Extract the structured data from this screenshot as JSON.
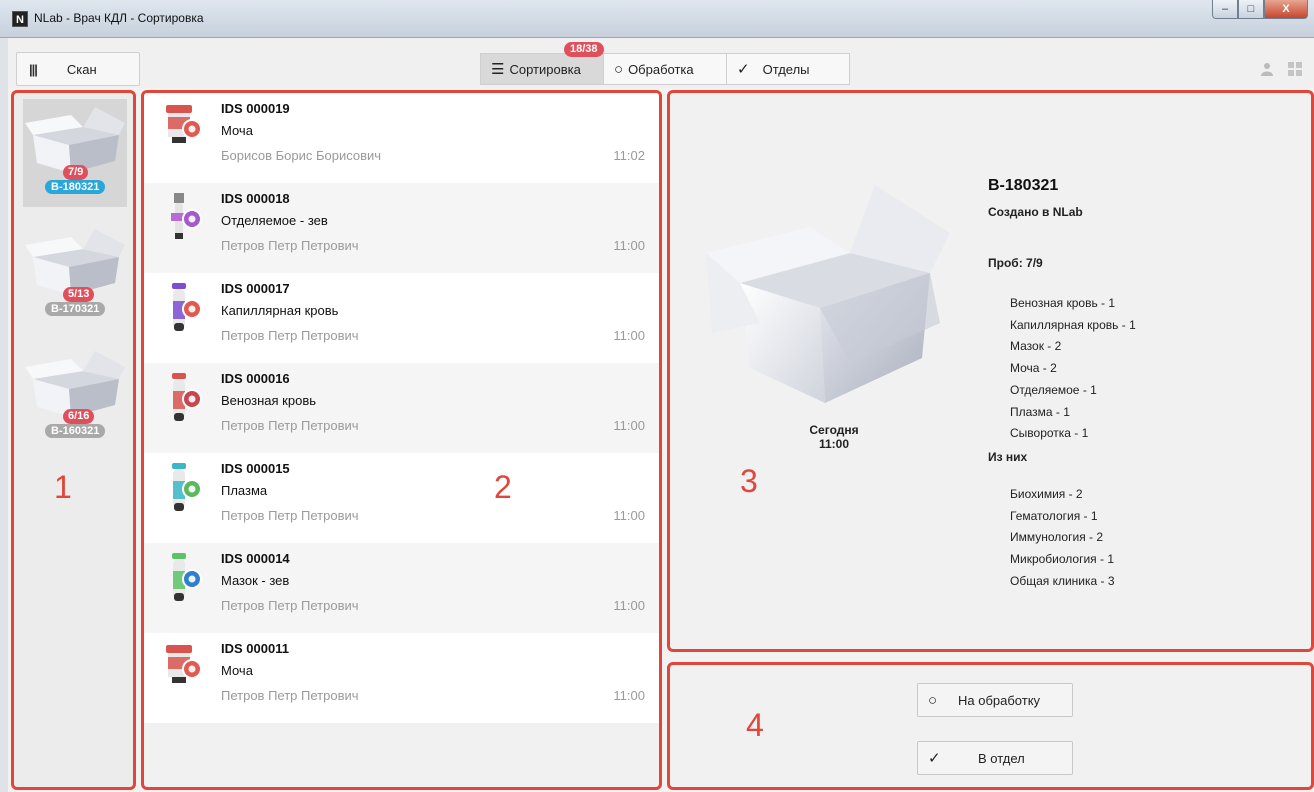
{
  "window": {
    "title": "NLab - Врач КДЛ - Сортировка",
    "app_icon": "N"
  },
  "toolbar": {
    "scan_label": "Скан",
    "tabs": [
      {
        "label": "Сортировка",
        "icon": "menu-icon",
        "active": true
      },
      {
        "label": "Обработка",
        "icon": "circle-icon",
        "active": false
      },
      {
        "label": "Отделы",
        "icon": "check-icon",
        "active": false
      }
    ],
    "badge": "18/38"
  },
  "annotations": {
    "n1": "1",
    "n2": "2",
    "n3": "3",
    "n4": "4"
  },
  "boxes": [
    {
      "count": "7/9",
      "code": "B-180321",
      "color": "#2aa7d9",
      "selected": true
    },
    {
      "count": "5/13",
      "code": "B-170321",
      "color": "#a9a9a9",
      "selected": false
    },
    {
      "count": "6/16",
      "code": "B-160321",
      "color": "#a9a9a9",
      "selected": false
    }
  ],
  "samples": [
    {
      "id": "IDS 000019",
      "type": "Моча",
      "patient": "Борисов Борис Борисович",
      "time": "11:02",
      "tube": "cup",
      "color": "#d9534f",
      "badge": "#e05a50"
    },
    {
      "id": "IDS 000018",
      "type": "Отделяемое -  зев",
      "patient": "Петров Петр Петрович",
      "time": "11:00",
      "tube": "swab",
      "color": "#b86ad9",
      "badge": "#a35acb"
    },
    {
      "id": "IDS 000017",
      "type": "Капиллярная кровь",
      "patient": "Петров Петр Петрович",
      "time": "11:00",
      "tube": "tube",
      "color": "#7b4fd0",
      "badge": "#e05a50"
    },
    {
      "id": "IDS 000016",
      "type": "Венозная кровь",
      "patient": "Петров Петр Петрович",
      "time": "11:00",
      "tube": "tube",
      "color": "#d9534f",
      "badge": "#c9464e"
    },
    {
      "id": "IDS 000015",
      "type": "Плазма",
      "patient": "Петров Петр Петрович",
      "time": "11:00",
      "tube": "tube",
      "color": "#3bb7c8",
      "badge": "#5cb85c"
    },
    {
      "id": "IDS 000014",
      "type": "Мазок -  зев",
      "patient": "Петров Петр Петрович",
      "time": "11:00",
      "tube": "tube",
      "color": "#5cc466",
      "badge": "#2f7fd0"
    },
    {
      "id": "IDS 000011",
      "type": "Моча",
      "patient": "Петров Петр Петрович",
      "time": "11:00",
      "tube": "cup",
      "color": "#d9534f",
      "badge": "#e05a50"
    }
  ],
  "detail": {
    "code": "B-180321",
    "created": "Создано в NLab",
    "date_line1": "Сегодня",
    "date_line2": "11:00",
    "probes": "Проб: 7/9",
    "probe_list": [
      "Венозная кровь - 1",
      "Капиллярная кровь - 1",
      "Мазок - 2",
      "Моча - 2",
      "Отделяемое - 1",
      "Плазма - 1",
      "Сыворотка - 1"
    ],
    "of_them": "Из них",
    "dept_list": [
      "Биохимия - 2",
      "Гематология - 1",
      "Иммунология - 2",
      "Микробиология - 1",
      "Общая клиника - 3"
    ]
  },
  "actions": {
    "process_label": "На обработку",
    "dept_label": "В отдел"
  }
}
